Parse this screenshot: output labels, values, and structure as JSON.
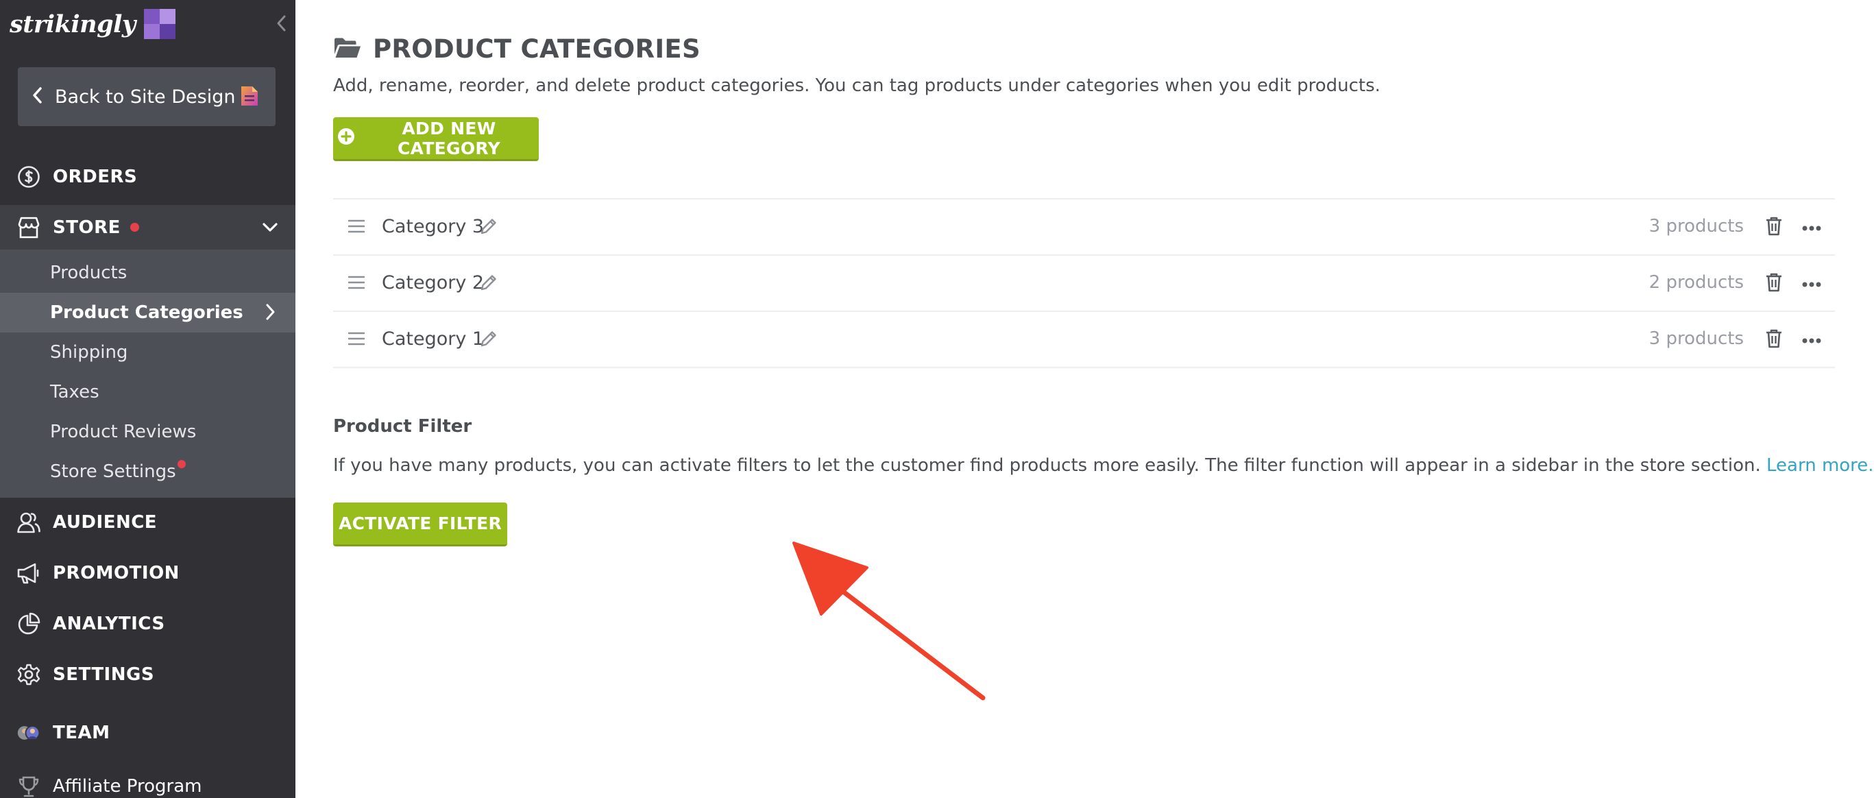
{
  "brand": {
    "name": "strikingly",
    "logo_colors": [
      "#7e56c2",
      "#b493e6",
      "#9c74d8",
      "#5f3ea3"
    ]
  },
  "sidebar": {
    "back_label": "Back to Site Design",
    "nav": {
      "orders": "ORDERS",
      "store": "STORE",
      "audience": "AUDIENCE",
      "promotion": "PROMOTION",
      "analytics": "ANALYTICS",
      "settings": "SETTINGS",
      "team": "TEAM",
      "affiliate": "Affiliate Program"
    },
    "store_sub": {
      "products": "Products",
      "product_categories": "Product Categories",
      "shipping": "Shipping",
      "taxes": "Taxes",
      "product_reviews": "Product Reviews",
      "store_settings": "Store Settings"
    },
    "active_item": "Product Categories"
  },
  "main": {
    "title": "PRODUCT CATEGORIES",
    "subtitle": "Add, rename, reorder, and delete product categories. You can tag products under categories when you edit products.",
    "add_button": "ADD NEW CATEGORY",
    "categories": [
      {
        "name": "Category 3",
        "count": "3 products"
      },
      {
        "name": "Category 2",
        "count": "2 products"
      },
      {
        "name": "Category 1",
        "count": "3 products"
      }
    ],
    "filter": {
      "title": "Product Filter",
      "description": "If you have many products, you can activate filters to let the customer find products more easily. The filter function will appear in a sidebar in the store section.",
      "link": "Learn more.",
      "button": "ACTIVATE FILTER"
    }
  },
  "colors": {
    "sidebar_bg": "#313135",
    "accent_green": "#96bd1c",
    "link_blue": "#33a3c7",
    "alert_red": "#e9414a",
    "annotation_arrow": "#f0412b"
  }
}
